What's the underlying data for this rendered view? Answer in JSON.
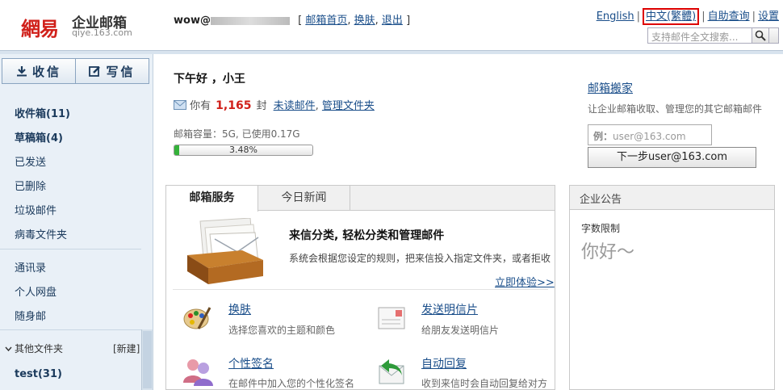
{
  "header": {
    "logo_text": "網易",
    "logo_sub": "企业邮箱",
    "logo_domain": "qiye.163.com",
    "username": "wow@",
    "links": [
      "邮箱首页",
      "换肤",
      "退出",
      "设置"
    ],
    "top_links": [
      "English",
      "中文(繁體)",
      "自助查询",
      "设置"
    ],
    "search_placeholder": "支持邮件全文搜索..."
  },
  "sidebar": {
    "receive": "收信",
    "compose": "写信",
    "inbox": "收件箱(11)",
    "drafts": "草稿箱(4)",
    "sent": "已发送",
    "deleted": "已删除",
    "spam": "垃圾邮件",
    "virus": "病毒文件夹",
    "contacts": "通讯录",
    "netdisk": "个人网盘",
    "mobile": "随身邮",
    "other_folders": "其他文件夹",
    "new_folder": "[新建]",
    "test_folder": "test(31)"
  },
  "main": {
    "greeting": "下午好 ，小王",
    "you_have": "你有",
    "mail_count": "1,165",
    "unit": "封",
    "unread": "未读邮件",
    "manage": "管理文件夹",
    "capacity": "邮箱容量：5G, 已使用0.17G",
    "usage_percent_label": "3.48%",
    "usage_fraction": 0.0348
  },
  "migrate": {
    "title": "邮箱搬家",
    "desc": "让企业邮箱收取、管理您的其它邮箱邮件",
    "input_prefix": "例：",
    "input_value": "user@163.com",
    "button": "下一步user@163.com"
  },
  "services": {
    "tab1": "邮箱服务",
    "tab2": "今日新闻",
    "feature_title": "来信分类, 轻松分类和管理邮件",
    "feature_desc": "系统会根据您设定的规则，把来信投入指定文件夹，或者拒收",
    "feature_link": "立即体验>>",
    "items": [
      {
        "title": "换肤",
        "desc": "选择您喜欢的主题和颜色"
      },
      {
        "title": "发送明信片",
        "desc": "给朋友发送明信片"
      },
      {
        "title": "个性签名",
        "desc": "在邮件中加入您的个性化签名"
      },
      {
        "title": "自动回复",
        "desc": "收到来信时会自动回复给对方"
      }
    ]
  },
  "announcement": {
    "title": "企业公告",
    "limit": "字数限制",
    "content": "你好～"
  },
  "colors": {
    "brand": "#d0201a",
    "link": "#1a4e8a",
    "progress": "#34b23a"
  }
}
